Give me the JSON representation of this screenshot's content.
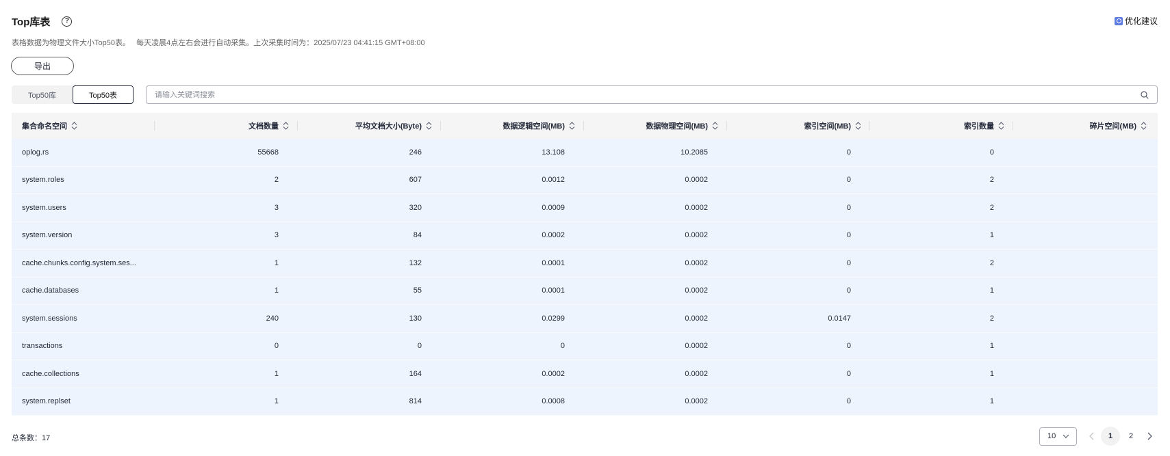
{
  "header": {
    "title": "Top库表",
    "help_icon": "question-circle-icon",
    "advice_label": "优化建议",
    "advice_icon": "lightbulb-icon",
    "description": "表格数据为物理文件大小Top50表。   每天凌晨4点左右会进行自动采集。上次采集时间为：2025/07/23 04:41:15 GMT+08:00"
  },
  "toolbar": {
    "export_label": "导出"
  },
  "segment": {
    "tab_db": "Top50库",
    "tab_table": "Top50表",
    "selected": "Top50表"
  },
  "search": {
    "placeholder": "请输入关键词搜索",
    "value": ""
  },
  "table": {
    "columns": [
      "集合命名空间",
      "文档数量",
      "平均文档大小(Byte)",
      "数据逻辑空间(MB)",
      "数据物理空间(MB)",
      "索引空间(MB)",
      "索引数量",
      "碎片空间(MB)"
    ],
    "rows": [
      [
        "oplog.rs",
        "55668",
        "246",
        "13.108",
        "10.2085",
        "0",
        "0",
        ""
      ],
      [
        "system.roles",
        "2",
        "607",
        "0.0012",
        "0.0002",
        "0",
        "2",
        ""
      ],
      [
        "system.users",
        "3",
        "320",
        "0.0009",
        "0.0002",
        "0",
        "2",
        ""
      ],
      [
        "system.version",
        "3",
        "84",
        "0.0002",
        "0.0002",
        "0",
        "1",
        ""
      ],
      [
        "cache.chunks.config.system.ses...",
        "1",
        "132",
        "0.0001",
        "0.0002",
        "0",
        "2",
        ""
      ],
      [
        "cache.databases",
        "1",
        "55",
        "0.0001",
        "0.0002",
        "0",
        "1",
        ""
      ],
      [
        "system.sessions",
        "240",
        "130",
        "0.0299",
        "0.0002",
        "0.0147",
        "2",
        ""
      ],
      [
        "transactions",
        "0",
        "0",
        "0",
        "0.0002",
        "0",
        "1",
        ""
      ],
      [
        "cache.collections",
        "1",
        "164",
        "0.0002",
        "0.0002",
        "0",
        "1",
        ""
      ],
      [
        "system.replset",
        "1",
        "814",
        "0.0008",
        "0.0002",
        "0",
        "1",
        ""
      ]
    ]
  },
  "footer": {
    "total_label": "总条数：17",
    "page_size": "10",
    "pages": [
      "1",
      "2"
    ],
    "current_page": "1"
  },
  "colors": {
    "row_bg": "#eef4fd",
    "header_bg": "#f5f5f6",
    "accent": "#5e7ce0"
  }
}
